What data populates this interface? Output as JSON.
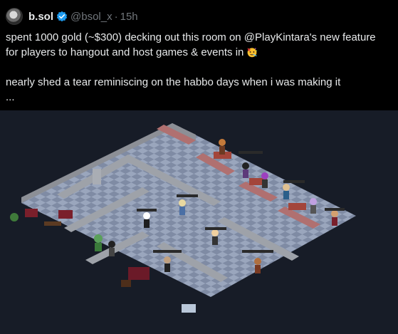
{
  "tweet": {
    "display_name": "b.sol",
    "handle": "@bsol_x",
    "separator": "·",
    "time": "15h",
    "text_line1": "spent 1000 gold (~$300) decking out this room on @PlayKintara's new feature",
    "text_line2": "for players to hangout and host games & events in",
    "text_line3": "nearly shed a tear reminiscing on the habbo days when i was making it",
    "text_line4": "...",
    "emoji": "party-face-emoji",
    "verified_color": "#1d9bf0"
  },
  "media": {
    "type": "isometric-game-room-screenshot",
    "background": "#171c27",
    "floor_color_a": "#9aa6bd",
    "floor_color_b": "#7f8ba4",
    "wall_color": "#8c8f96",
    "wall_top": "#b4b7bd"
  }
}
